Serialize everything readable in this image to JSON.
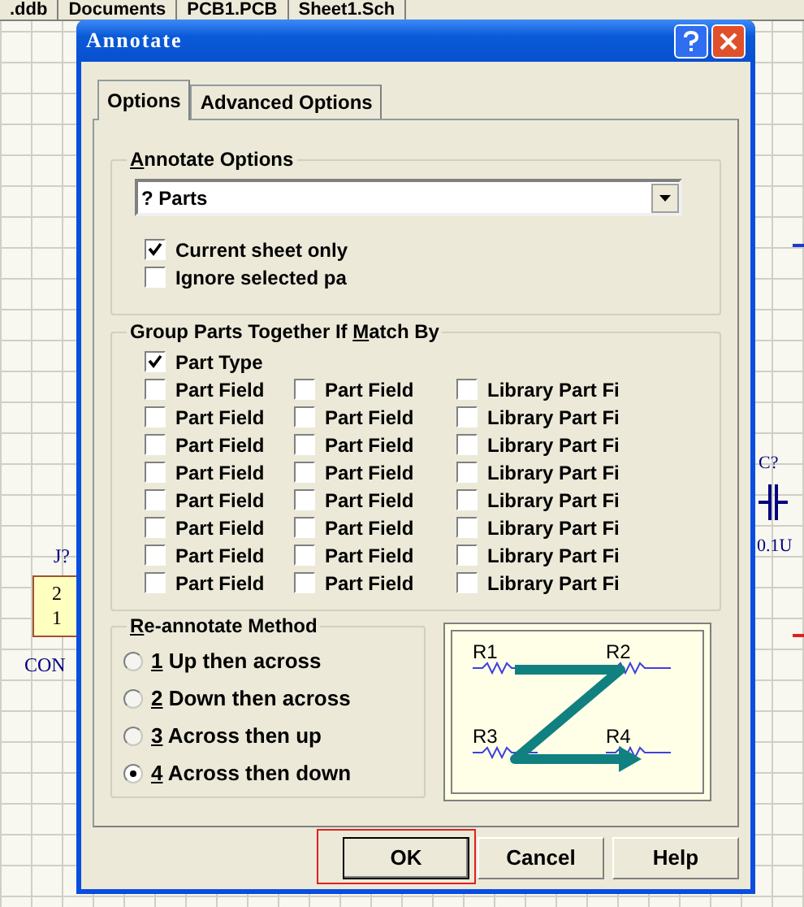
{
  "document_tabs": [
    {
      "label": ".ddb"
    },
    {
      "label": "Documents"
    },
    {
      "label": "PCB1.PCB"
    },
    {
      "label": "Sheet1.Sch"
    }
  ],
  "schematic": {
    "connector": {
      "designator": "J?",
      "pins": [
        "2",
        "1"
      ],
      "value": "CON"
    },
    "capacitor": {
      "designator": "C?",
      "value": "0.1U"
    }
  },
  "window": {
    "title": "Annotate"
  },
  "tabs": [
    {
      "label": "Options",
      "selected": true
    },
    {
      "label": "Advanced Options",
      "selected": false
    }
  ],
  "annotate_options": {
    "title": {
      "key": "A",
      "after": "nnotate Options"
    },
    "select": {
      "value": "? Parts"
    },
    "checkboxes": [
      {
        "label": "Current sheet only",
        "checked": true
      },
      {
        "label": "Ignore selected pa",
        "checked": false
      }
    ]
  },
  "group_parts": {
    "title": {
      "before": "Group Parts Together If ",
      "key": "M",
      "after": "atch By"
    },
    "part_type": {
      "label": "Part Type",
      "checked": true
    },
    "rows": [
      [
        {
          "label": "Part Field",
          "checked": false
        },
        {
          "label": "Part Field",
          "checked": false
        },
        {
          "label": "Library Part Fi",
          "checked": false
        }
      ],
      [
        {
          "label": "Part Field",
          "checked": false
        },
        {
          "label": "Part Field",
          "checked": false
        },
        {
          "label": "Library Part Fi",
          "checked": false
        }
      ],
      [
        {
          "label": "Part Field",
          "checked": false
        },
        {
          "label": "Part Field",
          "checked": false
        },
        {
          "label": "Library Part Fi",
          "checked": false
        }
      ],
      [
        {
          "label": "Part Field",
          "checked": false
        },
        {
          "label": "Part Field",
          "checked": false
        },
        {
          "label": "Library Part Fi",
          "checked": false
        }
      ],
      [
        {
          "label": "Part Field",
          "checked": false
        },
        {
          "label": "Part Field",
          "checked": false
        },
        {
          "label": "Library Part Fi",
          "checked": false
        }
      ],
      [
        {
          "label": "Part Field",
          "checked": false
        },
        {
          "label": "Part Field",
          "checked": false
        },
        {
          "label": "Library Part Fi",
          "checked": false
        }
      ],
      [
        {
          "label": "Part Field",
          "checked": false
        },
        {
          "label": "Part Field",
          "checked": false
        },
        {
          "label": "Library Part Fi",
          "checked": false
        }
      ],
      [
        {
          "label": "Part Field",
          "checked": false
        },
        {
          "label": "Part Field",
          "checked": false
        },
        {
          "label": "Library Part Fi",
          "checked": false
        }
      ]
    ]
  },
  "reannotate_method": {
    "title": {
      "key": "R",
      "after": "e-annotate Method"
    },
    "options": [
      {
        "key": "1",
        "label": " Up then across",
        "selected": false
      },
      {
        "key": "2",
        "label": " Down then across",
        "selected": false
      },
      {
        "key": "3",
        "label": " Across then up",
        "selected": false
      },
      {
        "key": "4",
        "label": " Across then down",
        "selected": true
      }
    ]
  },
  "preview": {
    "labels": [
      "R1",
      "R2",
      "R3",
      "R4"
    ]
  },
  "buttons": [
    {
      "label": "OK",
      "default": true
    },
    {
      "label": "Cancel",
      "default": false
    },
    {
      "label": "Help",
      "default": false
    }
  ]
}
